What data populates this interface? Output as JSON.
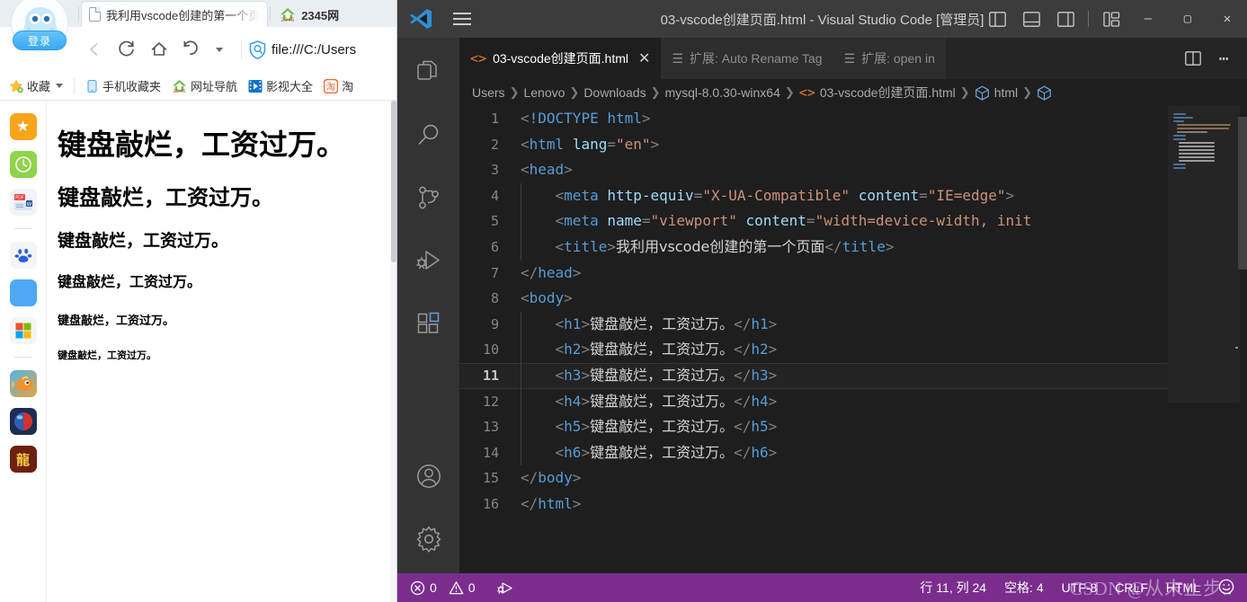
{
  "browser": {
    "account": {
      "login_label": "登录",
      "avatar_icon": "octopus-avatar-icon"
    },
    "tabs": [
      {
        "label": "我利用vscode创建的第一个页",
        "icon": "page-icon",
        "active": true
      },
      {
        "label": "2345网",
        "icon": "2345-icon",
        "active": false
      }
    ],
    "toolbar": {
      "back_icon": "back-arrow-icon",
      "reload_icon": "reload-icon",
      "home_icon": "home-icon",
      "history_icon": "history-back-icon",
      "dropdown_icon": "chevron-down-icon",
      "security_icon": "shield-icon",
      "url": "file:///C:/Users"
    },
    "bookmarks": [
      {
        "label": "收藏",
        "icon": "star-icon",
        "has_caret": true
      },
      {
        "label": "手机收藏夹",
        "icon": "phone-icon",
        "has_caret": false
      },
      {
        "label": "网址导航",
        "icon": "2345-icon",
        "has_caret": false
      },
      {
        "label": "影视大全",
        "icon": "video-icon",
        "has_caret": false
      },
      {
        "label": "淘",
        "icon": "taobao-icon",
        "has_caret": false
      }
    ],
    "side_rail": [
      {
        "name": "favorites-icon",
        "color": "#f7a51c",
        "glyph": "★"
      },
      {
        "name": "history-clock-icon",
        "color": "#8fd44a",
        "glyph": "🕐"
      },
      {
        "name": "pdf-to-word-icon",
        "color": "#f2f4f7",
        "glyph": "PW"
      },
      {
        "name": "divider",
        "color": "",
        "glyph": ""
      },
      {
        "name": "baidu-icon",
        "color": "#f3f5f7",
        "glyph": "du"
      },
      {
        "name": "blue-app-icon",
        "color": "#4ea8f2",
        "glyph": ""
      },
      {
        "name": "microsoft-icon",
        "color": "#f3f5f7",
        "glyph": ""
      },
      {
        "name": "divider",
        "color": "",
        "glyph": ""
      },
      {
        "name": "fish-game-icon",
        "color": "#e8a33d",
        "glyph": ""
      },
      {
        "name": "marble-game-icon",
        "color": "#2b3a6b",
        "glyph": ""
      },
      {
        "name": "dragon-game-icon",
        "color": "#6d1f10",
        "glyph": "龍"
      }
    ],
    "page": {
      "headings": [
        {
          "level": "h1",
          "text": "键盘敲烂，工资过万。"
        },
        {
          "level": "h2",
          "text": "键盘敲烂，工资过万。"
        },
        {
          "level": "h3",
          "text": "键盘敲烂，工资过万。"
        },
        {
          "level": "h4",
          "text": "键盘敲烂，工资过万。"
        },
        {
          "level": "h5",
          "text": "键盘敲烂，工资过万。"
        },
        {
          "level": "h6",
          "text": "键盘敲烂，工资过万。"
        }
      ]
    }
  },
  "vscode": {
    "titlebar": {
      "logo_icon": "vscode-logo-icon",
      "menu_icon": "hamburger-menu-icon",
      "title": "03-vscode创建页面.html - Visual Studio Code [管理员]",
      "layout_icons": [
        "toggle-primary-sidebar-icon",
        "toggle-panel-icon",
        "toggle-secondary-sidebar-icon",
        "customize-layout-icon"
      ],
      "window_controls": [
        {
          "name": "minimize-button",
          "glyph": "—"
        },
        {
          "name": "maximize-button",
          "glyph": "▢"
        },
        {
          "name": "close-button",
          "glyph": "✕"
        }
      ]
    },
    "activitybar": [
      {
        "name": "explorer-icon"
      },
      {
        "name": "search-icon"
      },
      {
        "name": "source-control-icon"
      },
      {
        "name": "run-and-debug-icon"
      },
      {
        "name": "extensions-icon"
      },
      {
        "name": "accounts-icon"
      },
      {
        "name": "settings-gear-icon"
      }
    ],
    "tabs": [
      {
        "label": "03-vscode创建页面.html",
        "icon": "html-file-icon",
        "active": true,
        "close_glyph": "✕"
      },
      {
        "label": "扩展: Auto Rename Tag",
        "icon": "extension-icon",
        "active": false
      },
      {
        "label": "扩展: open in",
        "icon": "extension-icon",
        "active": false
      }
    ],
    "tab_actions": [
      {
        "name": "split-editor-right-icon",
        "glyph": ""
      },
      {
        "name": "more-actions-icon",
        "glyph": "⋯"
      }
    ],
    "breadcrumbs": [
      {
        "label": "Users",
        "icon": ""
      },
      {
        "label": "Lenovo",
        "icon": ""
      },
      {
        "label": "Downloads",
        "icon": ""
      },
      {
        "label": "mysql-8.0.30-winx64",
        "icon": ""
      },
      {
        "label": "03-vscode创建页面.html",
        "icon": "html-file-icon"
      },
      {
        "label": "html",
        "icon": "symbol-field-icon"
      },
      {
        "label": "",
        "icon": "symbol-field-icon"
      }
    ],
    "editor": {
      "current_line": 11,
      "lines": [
        {
          "n": 1,
          "indent": 0,
          "segments": [
            {
              "t": "punc",
              "v": "<"
            },
            {
              "t": "doct",
              "v": "!DOCTYPE html"
            },
            {
              "t": "punc",
              "v": ">"
            }
          ]
        },
        {
          "n": 2,
          "indent": 0,
          "segments": [
            {
              "t": "punc",
              "v": "<"
            },
            {
              "t": "tag",
              "v": "html"
            },
            {
              "t": "plain",
              "v": " "
            },
            {
              "t": "attr",
              "v": "lang"
            },
            {
              "t": "punc",
              "v": "="
            },
            {
              "t": "str",
              "v": "\"en\""
            },
            {
              "t": "punc",
              "v": ">"
            }
          ]
        },
        {
          "n": 3,
          "indent": 0,
          "segments": [
            {
              "t": "punc",
              "v": "<"
            },
            {
              "t": "tag",
              "v": "head"
            },
            {
              "t": "punc",
              "v": ">"
            }
          ]
        },
        {
          "n": 4,
          "indent": 1,
          "segments": [
            {
              "t": "punc",
              "v": "    <"
            },
            {
              "t": "tag",
              "v": "meta"
            },
            {
              "t": "plain",
              "v": " "
            },
            {
              "t": "attr",
              "v": "http-equiv"
            },
            {
              "t": "punc",
              "v": "="
            },
            {
              "t": "str",
              "v": "\"X-UA-Compatible\""
            },
            {
              "t": "plain",
              "v": " "
            },
            {
              "t": "attr",
              "v": "content"
            },
            {
              "t": "punc",
              "v": "="
            },
            {
              "t": "str",
              "v": "\"IE=edge\""
            },
            {
              "t": "punc",
              "v": ">"
            }
          ]
        },
        {
          "n": 5,
          "indent": 1,
          "segments": [
            {
              "t": "punc",
              "v": "    <"
            },
            {
              "t": "tag",
              "v": "meta"
            },
            {
              "t": "plain",
              "v": " "
            },
            {
              "t": "attr",
              "v": "name"
            },
            {
              "t": "punc",
              "v": "="
            },
            {
              "t": "str",
              "v": "\"viewport\""
            },
            {
              "t": "plain",
              "v": " "
            },
            {
              "t": "attr",
              "v": "content"
            },
            {
              "t": "punc",
              "v": "="
            },
            {
              "t": "str",
              "v": "\"width=device-width, init"
            }
          ]
        },
        {
          "n": 6,
          "indent": 1,
          "segments": [
            {
              "t": "punc",
              "v": "    <"
            },
            {
              "t": "tag",
              "v": "title"
            },
            {
              "t": "punc",
              "v": ">"
            },
            {
              "t": "txt",
              "v": "我利用vscode创建的第一个页面"
            },
            {
              "t": "punc",
              "v": "</"
            },
            {
              "t": "tag",
              "v": "title"
            },
            {
              "t": "punc",
              "v": ">"
            }
          ]
        },
        {
          "n": 7,
          "indent": 0,
          "segments": [
            {
              "t": "punc",
              "v": "</"
            },
            {
              "t": "tag",
              "v": "head"
            },
            {
              "t": "punc",
              "v": ">"
            }
          ]
        },
        {
          "n": 8,
          "indent": 0,
          "segments": [
            {
              "t": "punc",
              "v": "<"
            },
            {
              "t": "tag",
              "v": "body"
            },
            {
              "t": "punc",
              "v": ">"
            }
          ]
        },
        {
          "n": 9,
          "indent": 1,
          "segments": [
            {
              "t": "punc",
              "v": "    <"
            },
            {
              "t": "tag",
              "v": "h1"
            },
            {
              "t": "punc",
              "v": ">"
            },
            {
              "t": "txt",
              "v": "键盘敲烂，工资过万。"
            },
            {
              "t": "punc",
              "v": "</"
            },
            {
              "t": "tag",
              "v": "h1"
            },
            {
              "t": "punc",
              "v": ">"
            }
          ]
        },
        {
          "n": 10,
          "indent": 1,
          "segments": [
            {
              "t": "punc",
              "v": "    <"
            },
            {
              "t": "tag",
              "v": "h2"
            },
            {
              "t": "punc",
              "v": ">"
            },
            {
              "t": "txt",
              "v": "键盘敲烂，工资过万。"
            },
            {
              "t": "punc",
              "v": "</"
            },
            {
              "t": "tag",
              "v": "h2"
            },
            {
              "t": "punc",
              "v": ">"
            }
          ]
        },
        {
          "n": 11,
          "indent": 1,
          "segments": [
            {
              "t": "punc",
              "v": "    <"
            },
            {
              "t": "tag",
              "v": "h3"
            },
            {
              "t": "punc",
              "v": ">"
            },
            {
              "t": "txt",
              "v": "键盘敲烂，工资过万。"
            },
            {
              "t": "punc",
              "v": "</"
            },
            {
              "t": "tag",
              "v": "h3"
            },
            {
              "t": "punc",
              "v": ">"
            }
          ]
        },
        {
          "n": 12,
          "indent": 1,
          "segments": [
            {
              "t": "punc",
              "v": "    <"
            },
            {
              "t": "tag",
              "v": "h4"
            },
            {
              "t": "punc",
              "v": ">"
            },
            {
              "t": "txt",
              "v": "键盘敲烂，工资过万。"
            },
            {
              "t": "punc",
              "v": "</"
            },
            {
              "t": "tag",
              "v": "h4"
            },
            {
              "t": "punc",
              "v": ">"
            }
          ]
        },
        {
          "n": 13,
          "indent": 1,
          "segments": [
            {
              "t": "punc",
              "v": "    <"
            },
            {
              "t": "tag",
              "v": "h5"
            },
            {
              "t": "punc",
              "v": ">"
            },
            {
              "t": "txt",
              "v": "键盘敲烂，工资过万。"
            },
            {
              "t": "punc",
              "v": "</"
            },
            {
              "t": "tag",
              "v": "h5"
            },
            {
              "t": "punc",
              "v": ">"
            }
          ]
        },
        {
          "n": 14,
          "indent": 1,
          "segments": [
            {
              "t": "punc",
              "v": "    <"
            },
            {
              "t": "tag",
              "v": "h6"
            },
            {
              "t": "punc",
              "v": ">"
            },
            {
              "t": "txt",
              "v": "键盘敲烂，工资过万。"
            },
            {
              "t": "punc",
              "v": "</"
            },
            {
              "t": "tag",
              "v": "h6"
            },
            {
              "t": "punc",
              "v": ">"
            }
          ]
        },
        {
          "n": 15,
          "indent": 0,
          "segments": [
            {
              "t": "punc",
              "v": "</"
            },
            {
              "t": "tag",
              "v": "body"
            },
            {
              "t": "punc",
              "v": ">"
            }
          ]
        },
        {
          "n": 16,
          "indent": 0,
          "segments": [
            {
              "t": "punc",
              "v": "</"
            },
            {
              "t": "tag",
              "v": "html"
            },
            {
              "t": "punc",
              "v": ">"
            }
          ]
        }
      ]
    },
    "statusbar": {
      "errors_icon": "error-circle-icon",
      "errors": "0",
      "warnings_icon": "warning-triangle-icon",
      "warnings": "0",
      "ports_icon": "remote-ports-icon",
      "cursor_position": "行 11, 列 24",
      "indentation": "空格: 4",
      "encoding": "UTF-8",
      "eol": "CRLF",
      "language": "HTML",
      "feedback_icon": "smiley-icon",
      "background_color": "#7b2d8e"
    },
    "watermark": "CSDN @从末止步.."
  }
}
